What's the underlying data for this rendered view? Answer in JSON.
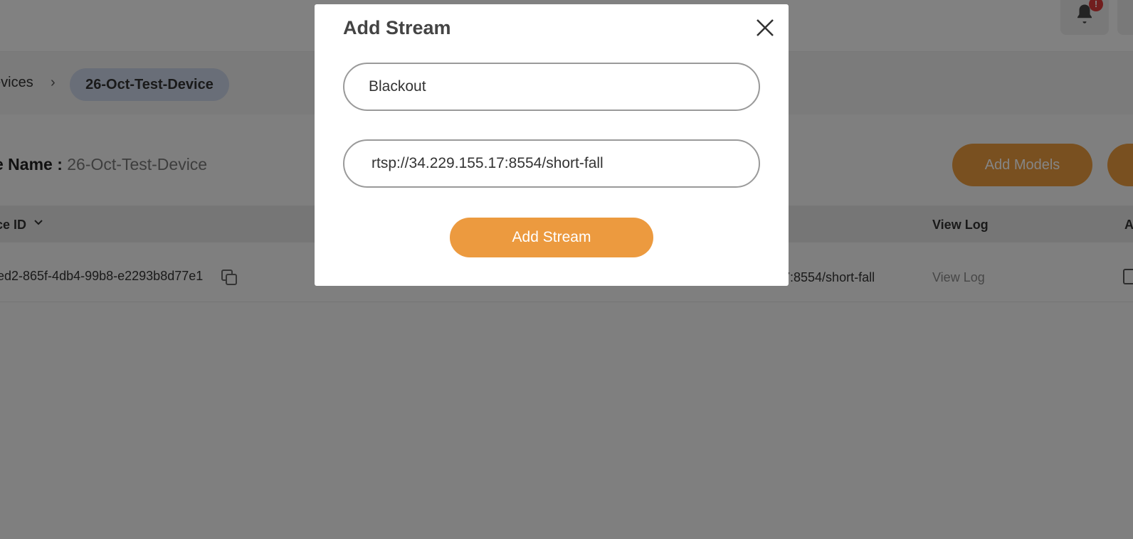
{
  "topbar": {
    "notification_badge": "!",
    "bell_icon": "bell-icon"
  },
  "breadcrumb": {
    "parent": "evices",
    "current": "26-Oct-Test-Device"
  },
  "device": {
    "name_label": "e Name :",
    "name_value": "26-Oct-Test-Device",
    "add_models_label": "Add Models"
  },
  "table": {
    "columns": [
      "ce ID",
      "View Log",
      "A"
    ],
    "rows": [
      {
        "id": "ed2-865f-4db4-99b8-e2293b8d77e1",
        "url": "7:8554/short-fall",
        "view_log": "View Log"
      }
    ]
  },
  "modal": {
    "title": "Add Stream",
    "name_value": "Blackout",
    "url_value": "rtsp://34.229.155.17:8554/short-fall",
    "submit_label": "Add Stream"
  },
  "colors": {
    "accent": "#ec9a3f",
    "breadcrumb_pill": "#c9d3e6",
    "badge": "#d93a3a"
  }
}
